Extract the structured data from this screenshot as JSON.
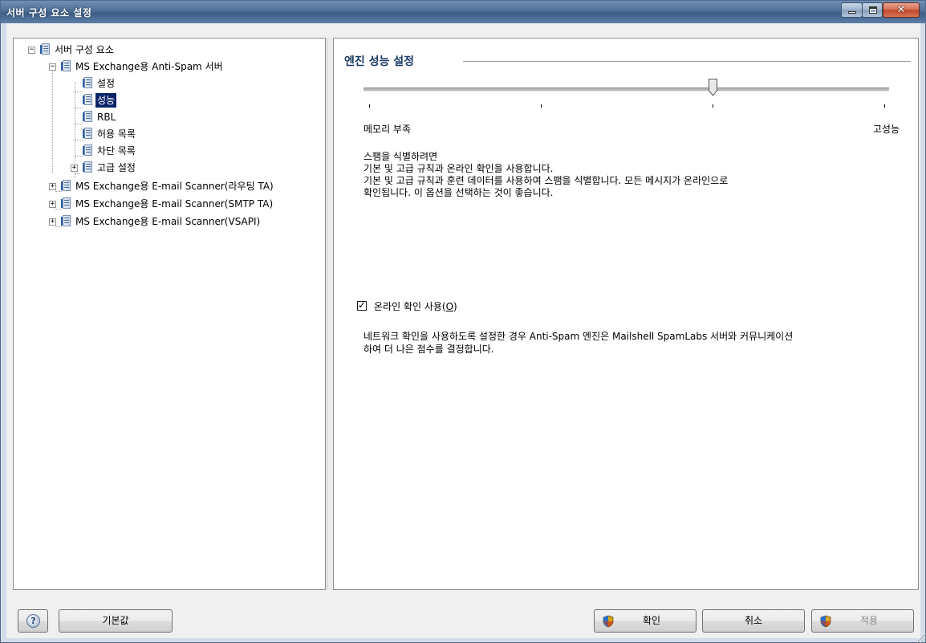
{
  "window": {
    "title": "서버 구성 요소 설정"
  },
  "tree": {
    "root": "서버 구성 요소",
    "antispam": "MS Exchange용 Anti-Spam 서버",
    "children": [
      "설정",
      "성능",
      "RBL",
      "허용 목록",
      "차단 목록",
      "고급 설정"
    ],
    "selected": "성능",
    "scanners": [
      "MS Exchange용 E-mail Scanner(라우팅 TA)",
      "MS Exchange용 E-mail Scanner(SMTP TA)",
      "MS Exchange용 E-mail Scanner(VSAPI)"
    ]
  },
  "main": {
    "section_title": "엔진 성능 설정",
    "slider": {
      "min_label": "메모리 부족",
      "max_label": "고성능",
      "tick_count": 4,
      "value_fraction": 0.666
    },
    "description": "스팸을 식별하려면\n기본 및 고급 규칙과 온라인 확인을 사용합니다.\n기본 및 고급 규칙과 훈련 데이터를 사용하여 스팸을 식별합니다. 모든 메시지가 온라인으로\n확인됩니다. 이 옵션을 선택하는 것이 좋습니다.",
    "online_check": {
      "label_prefix": "온라인 확인 사용(",
      "accel": "O",
      "label_suffix": ")",
      "checked": true
    },
    "network_description": "네트워크 확인을 사용하도록 설정한 경우 Anti-Spam 엔진은 Mailshell SpamLabs 서버와 커뮤니케이션\n하여 더 나은 점수를 결정합니다."
  },
  "buttons": {
    "help": "?",
    "defaults": "기본값",
    "ok": "확인",
    "cancel": "취소",
    "apply": "적용",
    "apply_enabled": false
  },
  "colors": {
    "selection": "#0a246a",
    "title_gradient": "#4f6f96",
    "section_title": "#1a3a66"
  }
}
